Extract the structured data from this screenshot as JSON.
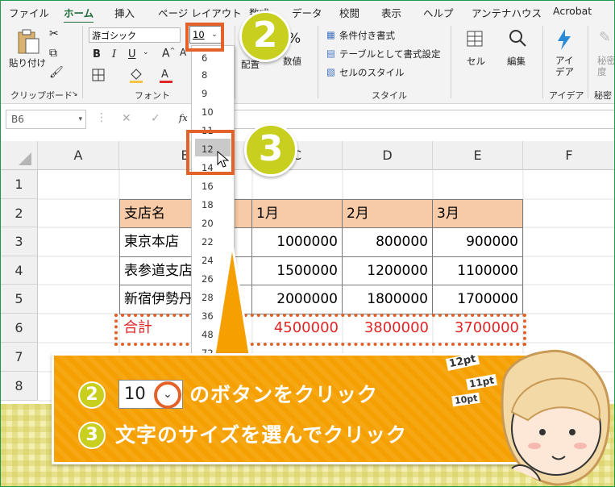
{
  "tabs": [
    "ファイル",
    "ホーム",
    "挿入",
    "ページ レイアウト",
    "数式",
    "データ",
    "校閲",
    "表示",
    "ヘルプ",
    "アンテナハウス",
    "Acrobat"
  ],
  "ribbon": {
    "paste_label": "貼り付け",
    "clipboard_group": "クリップボード",
    "font_name": "游ゴシック",
    "font_size": "10",
    "font_group": "フォント",
    "align_label": "配置",
    "number_label": "数値",
    "cond_format": "条件付き書式",
    "table_format": "テーブルとして書式設定",
    "cell_style": "セルのスタイル",
    "style_group": "スタイル",
    "cell_label": "セル",
    "edit_label": "編集",
    "idea_label": "アイデア",
    "idea_group": "アイデア",
    "secret_label": "秘密度",
    "secret_group": "秘密"
  },
  "formula_bar": {
    "name_box": "B6",
    "fx": "fx"
  },
  "font_size_options": [
    "8",
    "9",
    "10",
    "11",
    "12",
    "14",
    "16",
    "18",
    "20",
    "22",
    "24",
    "26",
    "28",
    "36",
    "48",
    "72"
  ],
  "font_size_partial_top": "6",
  "font_size_highlighted": "12",
  "columns": [
    "A",
    "B",
    "C",
    "D",
    "E",
    "F"
  ],
  "rows": [
    "1",
    "2",
    "3",
    "4",
    "5",
    "6",
    "7",
    "8"
  ],
  "table": {
    "header": [
      "支店名",
      "1月",
      "2月",
      "3月"
    ],
    "rows": [
      {
        "name": "東京本店",
        "jan": "1000000",
        "feb": "800000",
        "mar": "900000"
      },
      {
        "name": "表参道支店",
        "jan": "1500000",
        "feb": "1200000",
        "mar": "1100000"
      },
      {
        "name": "新宿伊勢丹",
        "jan": "2000000",
        "feb": "1800000",
        "mar": "1700000"
      }
    ],
    "total": {
      "name": "合計",
      "jan": "4500000",
      "feb": "3800000",
      "mar": "3700000"
    }
  },
  "steps": [
    {
      "num": "2",
      "size_value": "10",
      "text": "のボタンをクリック"
    },
    {
      "num": "3",
      "text": "文字のサイズを選んでクリック"
    }
  ],
  "step_badges": [
    "2",
    "3"
  ],
  "size_labels": [
    "12pt",
    "11pt",
    "10pt"
  ],
  "colors": {
    "accent_orange": "#e2622a",
    "panel": "#f5a000",
    "badge": "#c8cf1f",
    "header_fill": "#f8cba8",
    "total_red": "#e02525"
  }
}
